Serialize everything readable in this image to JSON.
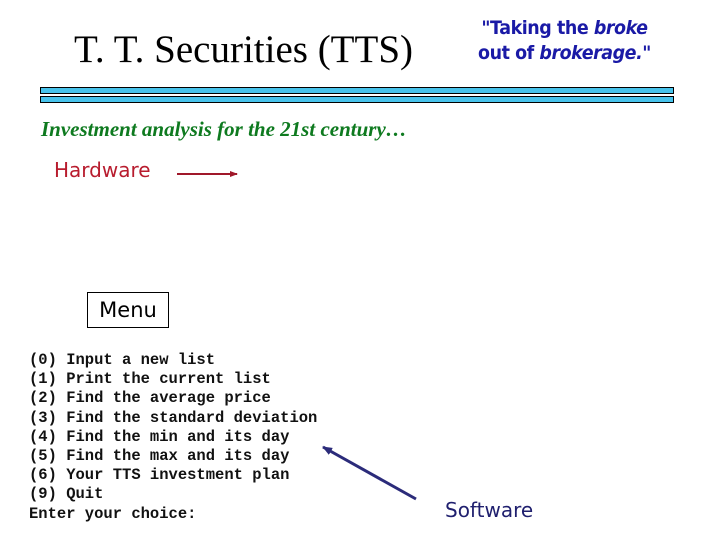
{
  "header": {
    "title": "T. T. Securities (TTS)",
    "slogan": {
      "line1_prefix": "\"Taking the ",
      "line1_emph": "broke",
      "line2_prefix": "out of ",
      "line2_emph": "brokerage.",
      "line2_suffix": "\""
    }
  },
  "subtitle": "Investment analysis for the 21st century…",
  "labels": {
    "hardware": "Hardware",
    "software": "Software",
    "menu": "Menu"
  },
  "console": {
    "lines": [
      "(0) Input a new list",
      "(1) Print the current list",
      "(2) Find the average price",
      "(3) Find the standard deviation",
      "(4) Find the min and its day",
      "(5) Find the max and its day",
      "(6) Your TTS investment plan",
      "(9) Quit",
      "Enter your choice:"
    ]
  },
  "colors": {
    "rule": "#47c3ec",
    "subtitle": "#0e7a1f",
    "hardware": "#b81c2e",
    "software": "#1f1f6e",
    "slogan": "#1a1aa6",
    "hardware_arrow": "#a0182a",
    "software_arrow": "#2b2b7a"
  }
}
